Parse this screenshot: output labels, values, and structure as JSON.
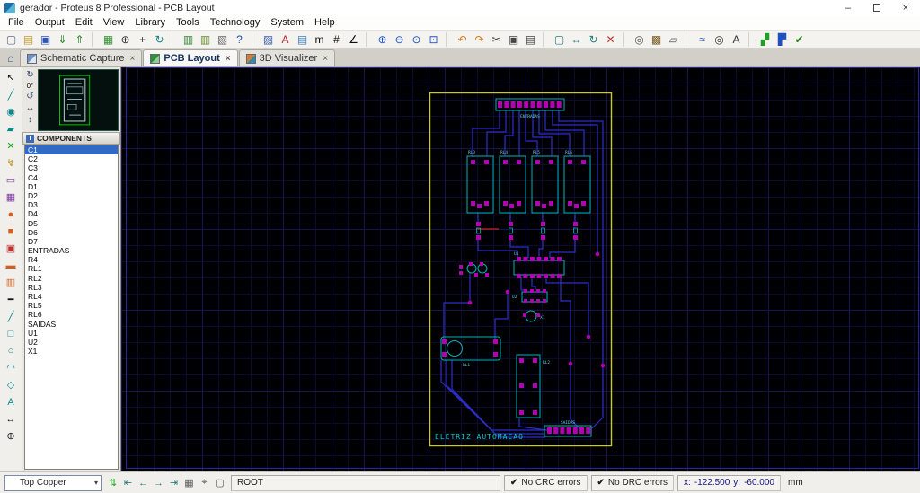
{
  "window": {
    "title": "gerador - Proteus 8 Professional - PCB Layout",
    "controls": {
      "minimize": "–",
      "close": "×"
    }
  },
  "menubar": [
    {
      "name": "menu-file",
      "label": "File"
    },
    {
      "name": "menu-output",
      "label": "Output"
    },
    {
      "name": "menu-edit",
      "label": "Edit"
    },
    {
      "name": "menu-view",
      "label": "View"
    },
    {
      "name": "menu-library",
      "label": "Library"
    },
    {
      "name": "menu-tools",
      "label": "Tools"
    },
    {
      "name": "menu-technology",
      "label": "Technology"
    },
    {
      "name": "menu-system",
      "label": "System"
    },
    {
      "name": "menu-help",
      "label": "Help"
    }
  ],
  "toolbar": [
    {
      "name": "new-design-icon",
      "glyph": "▢",
      "color": "#5a6a8a"
    },
    {
      "name": "open-design-icon",
      "glyph": "▤",
      "color": "#c09a28"
    },
    {
      "name": "save-design-icon",
      "glyph": "▣",
      "color": "#2f55b0"
    },
    {
      "name": "import-section-icon",
      "glyph": "⇓",
      "color": "#2e8b2e"
    },
    {
      "name": "export-section-icon",
      "glyph": "⇑",
      "color": "#2e8b2e"
    },
    {
      "name": "toolbar-separator",
      "glyph": "",
      "interactable": false,
      "sep": true
    },
    {
      "name": "grid-toggle-icon",
      "glyph": "▦",
      "color": "#2e8b2e"
    },
    {
      "name": "origin-icon",
      "glyph": "⊕",
      "color": "#333333"
    },
    {
      "name": "cursor-snap-icon",
      "glyph": "+",
      "color": "#333333"
    },
    {
      "name": "redraw-icon",
      "glyph": "↻",
      "color": "#0a8a8a"
    },
    {
      "name": "toolbar-separator",
      "glyph": "",
      "interactable": false,
      "sep": true
    },
    {
      "name": "library-picker-icon",
      "glyph": "▥",
      "color": "#2e8b2e"
    },
    {
      "name": "package-library-icon",
      "glyph": "▥",
      "color": "#6a8a2e"
    },
    {
      "name": "print-icon",
      "glyph": "▧",
      "color": "#666666"
    },
    {
      "name": "help-icon",
      "glyph": "?",
      "color": "#2050c0"
    },
    {
      "name": "toolbar-separator",
      "glyph": "",
      "interactable": false,
      "sep": true
    },
    {
      "name": "display-settings-icon",
      "glyph": "▨",
      "color": "#4060b0"
    },
    {
      "name": "text-style-icon",
      "glyph": "A",
      "color": "#b03030"
    },
    {
      "name": "design-explorer-icon",
      "glyph": "▤",
      "color": "#3f7fbf"
    },
    {
      "name": "metric-toggle-icon",
      "glyph": "m",
      "color": "#111111"
    },
    {
      "name": "snap-grid-icon",
      "glyph": "#",
      "color": "#111111"
    },
    {
      "name": "angle-lock-icon",
      "glyph": "∠",
      "color": "#111111"
    },
    {
      "name": "toolbar-separator",
      "glyph": "",
      "interactable": false,
      "sep": true
    },
    {
      "name": "zoom-in-icon",
      "glyph": "⊕",
      "color": "#2050c0"
    },
    {
      "name": "zoom-out-icon",
      "glyph": "⊖",
      "color": "#2050c0"
    },
    {
      "name": "zoom-all-icon",
      "glyph": "⊙",
      "color": "#2050c0"
    },
    {
      "name": "zoom-area-icon",
      "glyph": "⊡",
      "color": "#2050c0"
    },
    {
      "name": "toolbar-separator",
      "glyph": "",
      "interactable": false,
      "sep": true
    },
    {
      "name": "undo-icon",
      "glyph": "↶",
      "color": "#d07818"
    },
    {
      "name": "redo-icon",
      "glyph": "↷",
      "color": "#d07818"
    },
    {
      "name": "cut-icon",
      "glyph": "✂",
      "color": "#444444"
    },
    {
      "name": "copy-icon",
      "glyph": "▣",
      "color": "#444444"
    },
    {
      "name": "paste-icon",
      "glyph": "▤",
      "color": "#444444"
    },
    {
      "name": "toolbar-separator",
      "glyph": "",
      "interactable": false,
      "sep": true
    },
    {
      "name": "block-copy-icon",
      "glyph": "▢",
      "color": "#208080"
    },
    {
      "name": "block-move-icon",
      "glyph": "↔",
      "color": "#208080"
    },
    {
      "name": "block-rotate-icon",
      "glyph": "↻",
      "color": "#208080"
    },
    {
      "name": "block-delete-icon",
      "glyph": "✕",
      "color": "#c03030"
    },
    {
      "name": "toolbar-separator",
      "glyph": "",
      "interactable": false,
      "sep": true
    },
    {
      "name": "search-components-icon",
      "glyph": "◎",
      "color": "#555555"
    },
    {
      "name": "make-package-icon",
      "glyph": "▩",
      "color": "#7a5a20"
    },
    {
      "name": "decompose-icon",
      "glyph": "▱",
      "color": "#555555"
    },
    {
      "name": "toolbar-separator",
      "glyph": "",
      "interactable": false,
      "sep": true
    },
    {
      "name": "auto-router-icon",
      "glyph": "≈",
      "color": "#2050c0"
    },
    {
      "name": "search-tag-icon",
      "glyph": "◎",
      "color": "#333333"
    },
    {
      "name": "auto-name-icon",
      "glyph": "A",
      "color": "#333333"
    },
    {
      "name": "toolbar-separator",
      "glyph": "",
      "interactable": false,
      "sep": true
    },
    {
      "name": "ratsnest-icon",
      "glyph": "▞",
      "color": "#20a020"
    },
    {
      "name": "power-plane-icon",
      "glyph": "▛",
      "color": "#2050c0"
    },
    {
      "name": "drc-report-icon",
      "glyph": "✔",
      "color": "#208020"
    }
  ],
  "tabbar": {
    "home_glyph": "⌂",
    "close_glyph": "×",
    "tabs": [
      {
        "label": "Schematic Capture"
      },
      {
        "label": "PCB Layout"
      },
      {
        "label": "3D Visualizer"
      }
    ]
  },
  "left_toolbar": [
    {
      "name": "selection-mode-icon",
      "glyph": "↖",
      "color": "#111111"
    },
    {
      "name": "track-mode-icon",
      "glyph": "╱",
      "color": "#0a8a8a"
    },
    {
      "name": "via-mode-icon",
      "glyph": "◉",
      "color": "#0a8a8a"
    },
    {
      "name": "zone-mode-icon",
      "glyph": "▰",
      "color": "#0a8a8a"
    },
    {
      "name": "ratsnest-mode-icon",
      "glyph": "✕",
      "color": "#20a020"
    },
    {
      "name": "connectivity-highlight-icon",
      "glyph": "↯",
      "color": "#c09a20"
    },
    {
      "name": "component-mode-icon",
      "glyph": "▭",
      "color": "#7a30a0"
    },
    {
      "name": "package-mode-icon",
      "glyph": "▦",
      "color": "#7a30a0"
    },
    {
      "name": "round-pad-icon",
      "glyph": "●",
      "color": "#d06020"
    },
    {
      "name": "square-pad-icon",
      "glyph": "■",
      "color": "#d06020"
    },
    {
      "name": "dil-pad-icon",
      "glyph": "▣",
      "color": "#c03030"
    },
    {
      "name": "smt-pad-icon",
      "glyph": "▬",
      "color": "#d06020"
    },
    {
      "name": "padstack-icon",
      "glyph": "▥",
      "color": "#d06020"
    },
    {
      "name": "trace-style-icon",
      "glyph": "━",
      "color": "#111111"
    },
    {
      "name": "2d-line-icon",
      "glyph": "╱",
      "color": "#0a8a8a"
    },
    {
      "name": "2d-box-icon",
      "glyph": "□",
      "color": "#0a8a8a"
    },
    {
      "name": "2d-circle-icon",
      "glyph": "○",
      "color": "#0a8a8a"
    },
    {
      "name": "2d-arc-icon",
      "glyph": "◠",
      "color": "#0a8a8a"
    },
    {
      "name": "2d-path-icon",
      "glyph": "◇",
      "color": "#0a8a8a"
    },
    {
      "name": "2d-text-icon",
      "glyph": "A",
      "color": "#0a8a8a"
    },
    {
      "name": "dimension-icon",
      "glyph": "↔",
      "color": "#111111"
    },
    {
      "name": "origin-marker-icon",
      "glyph": "⊕",
      "color": "#111111"
    }
  ],
  "side_panel": {
    "rotation": {
      "cw": "↻",
      "angle": "0°",
      "ccw": "↺",
      "mirror_h": "↔",
      "mirror_v": "↕"
    },
    "components": {
      "header": "COMPONENTS",
      "icon_glyph": "T",
      "items": [
        {
          "label": "C1",
          "selected": true
        },
        "C2",
        "C3",
        "C4",
        "D1",
        "D2",
        "D3",
        "D4",
        "D5",
        "D6",
        "D7",
        "ENTRADAS",
        "R4",
        "RL1",
        "RL2",
        "RL3",
        "RL4",
        "RL5",
        "RL6",
        "SAIDAS",
        "U1",
        "U2",
        "X1"
      ]
    }
  },
  "pcb": {
    "board_text": "ELETRIZ AUTOMACAO",
    "colors": {
      "board_outline": "#c8c832",
      "silk": "#00b3b3",
      "trace": "#2e2ec8",
      "pad": "#b300b3",
      "label": "#5fd4d4"
    },
    "labels": [
      {
        "text": "ENTRADAS"
      },
      {
        "text": "RL3"
      },
      {
        "text": "RL4"
      },
      {
        "text": "RL5"
      },
      {
        "text": "RL6"
      },
      {
        "text": "U1"
      },
      {
        "text": "U2"
      },
      {
        "text": "X1"
      },
      {
        "text": "RL1"
      },
      {
        "text": "RL2"
      },
      {
        "text": "SAIDAS"
      }
    ]
  },
  "statusbar": {
    "layer_selector": {
      "value": "Top Copper",
      "swatch_color": "#00a651",
      "arrow": "▾"
    },
    "icons": [
      {
        "name": "layer-flip-icon",
        "glyph": "⇅",
        "color": "#20a020"
      },
      {
        "name": "goto-first-layer-icon",
        "glyph": "⇤",
        "color": "#208080"
      },
      {
        "name": "prev-layer-icon",
        "glyph": "←",
        "color": "#208080"
      },
      {
        "name": "next-layer-icon",
        "glyph": "→",
        "color": "#208080"
      },
      {
        "name": "goto-last-layer-icon",
        "glyph": "⇥",
        "color": "#208080"
      },
      {
        "name": "snap-indicator-icon",
        "glyph": "▦",
        "color": "#555555"
      },
      {
        "name": "select-filter-icon",
        "glyph": "⌖",
        "color": "#555555"
      },
      {
        "name": "clear-filter-icon",
        "glyph": "▢",
        "color": "#555555"
      }
    ],
    "sheet": "ROOT",
    "crc": {
      "icon": "✔",
      "text": "No CRC errors",
      "color": "#18a018"
    },
    "drc": {
      "icon": "✔",
      "text": "No DRC errors",
      "color": "#18a018"
    },
    "coords": {
      "x_label": "x:",
      "x_value": "-122.500",
      "y_label": "y:",
      "y_value": "-60.000",
      "units": "mm"
    }
  }
}
